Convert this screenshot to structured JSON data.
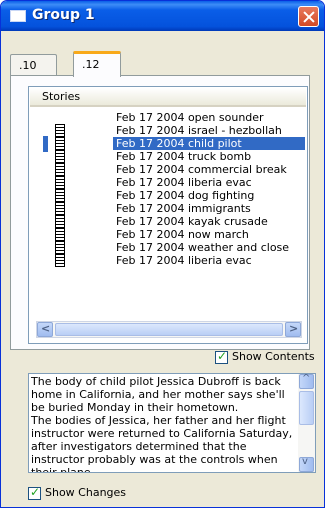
{
  "window": {
    "title": "Group 1",
    "title_icon": "window-icon",
    "close_icon": "close-icon",
    "colors": {
      "titlebar": "#0a5ee8",
      "close": "#d34a25",
      "selection": "#316ac5"
    }
  },
  "tabs": [
    {
      "label": ".10",
      "selected": false
    },
    {
      "label": ".12",
      "selected": true
    }
  ],
  "stories": {
    "header": "Stories",
    "selected_index": 2,
    "items": [
      {
        "label": "Feb 17 2004 open sounder",
        "icon": ""
      },
      {
        "label": "Feb 17 2004 israel - hezbollah",
        "icon": "document-icon"
      },
      {
        "label": "Feb 17 2004 child pilot",
        "icon": "document-icon"
      },
      {
        "label": "Feb 17 2004 truck bomb",
        "icon": "document-icon"
      },
      {
        "label": "Feb 17 2004 commercial break",
        "icon": "document-icon"
      },
      {
        "label": "Feb 17 2004 liberia evac",
        "icon": "document-icon"
      },
      {
        "label": "Feb 17 2004 dog fighting",
        "icon": "document-icon"
      },
      {
        "label": "Feb 17 2004 immigrants",
        "icon": "document-icon"
      },
      {
        "label": "Feb 17 2004 kayak crusade",
        "icon": "document-icon"
      },
      {
        "label": "Feb 17 2004 now march",
        "icon": "document-icon"
      },
      {
        "label": "Feb 17 2004 weather and close",
        "icon": "document-icon"
      },
      {
        "label": "Feb 17 2004 liberia evac",
        "icon": "document-icon"
      }
    ],
    "scroll_left_glyph": "<",
    "scroll_right_glyph": ">"
  },
  "show_contents": {
    "label": "Show Contents",
    "checked": true
  },
  "contents": {
    "text": "The body of child pilot Jessica Dubroff is back home in California, and her mother says she'll be buried Monday in their hometown.\nThe bodies of Jessica, her father and her flight instructor were returned to California Saturday, after investigators determined that the instructor probably was at the controls when their plane",
    "scroll_up_glyph": "^",
    "scroll_down_glyph": "v"
  },
  "show_changes": {
    "label": "Show Changes",
    "checked": true
  }
}
